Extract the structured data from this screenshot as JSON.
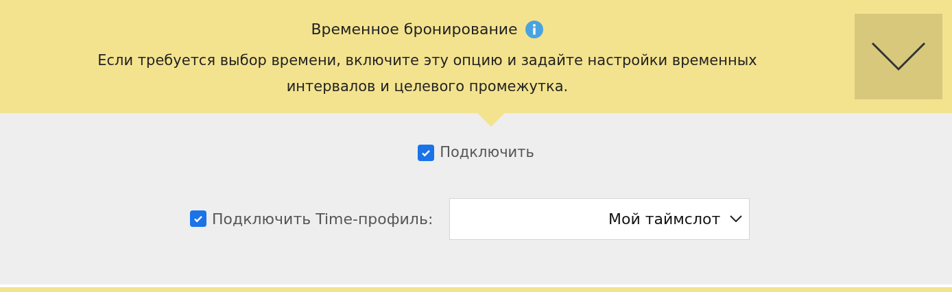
{
  "header": {
    "title": "Временное бронирование",
    "description": "Если требуется выбор времени, включите эту опцию и задайте настройки временных интервалов и целевого промежутка."
  },
  "enable": {
    "label": "Подключить",
    "checked": true
  },
  "time_profile": {
    "label": "Подключить Time-профиль:",
    "checked": true,
    "value": "Мой таймслот"
  }
}
